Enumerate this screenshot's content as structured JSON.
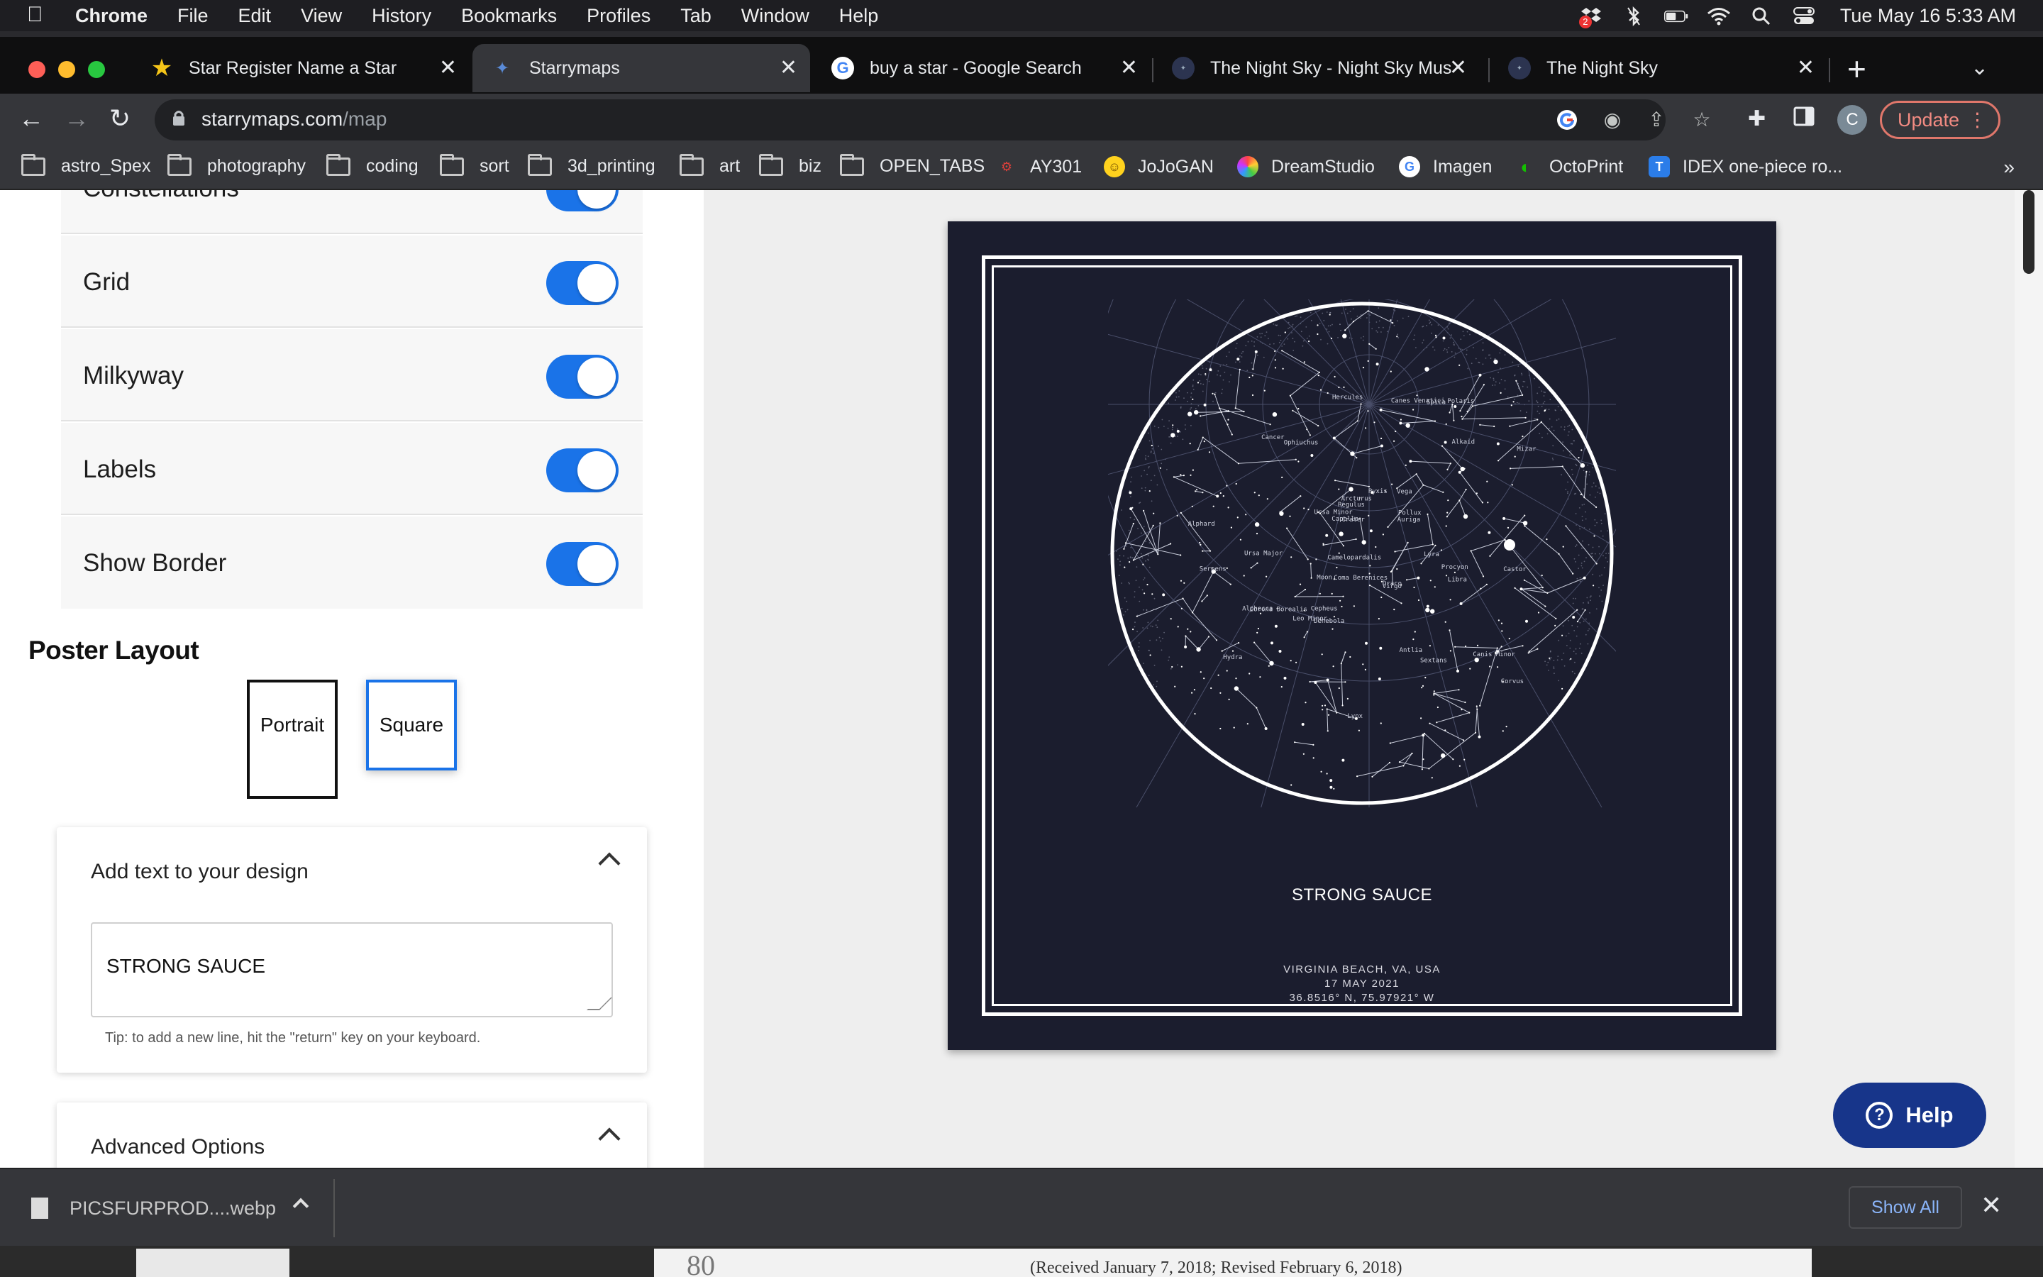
{
  "menubar": {
    "app_name": "Chrome",
    "items": [
      "File",
      "Edit",
      "View",
      "History",
      "Bookmarks",
      "Profiles",
      "Tab",
      "Window",
      "Help"
    ],
    "clock": "Tue May 16  5:33 AM",
    "badge": "2"
  },
  "tabs": [
    {
      "title": "Star Register Name a Star",
      "icon": "star-icon"
    },
    {
      "title": "Starrymaps",
      "icon": "starrymaps-icon"
    },
    {
      "title": "buy a star - Google Search",
      "icon": "google-icon"
    },
    {
      "title": "The Night Sky - Night Sky Mus",
      "icon": "nightsky-icon"
    },
    {
      "title": "The Night Sky",
      "icon": "nightsky-icon"
    }
  ],
  "address": {
    "domain": "starrymaps.com",
    "path": "/map"
  },
  "profile_initial": "C",
  "update_label": "Update",
  "bookmarks": [
    {
      "label": "astro_Spex",
      "type": "folder"
    },
    {
      "label": "photography",
      "type": "folder"
    },
    {
      "label": "coding",
      "type": "folder"
    },
    {
      "label": "sort",
      "type": "folder"
    },
    {
      "label": "3d_printing",
      "type": "folder"
    },
    {
      "label": "art",
      "type": "folder"
    },
    {
      "label": "biz",
      "type": "folder"
    },
    {
      "label": "OPEN_TABS",
      "type": "folder"
    },
    {
      "label": "AY301",
      "type": "site"
    },
    {
      "label": "JoJoGAN",
      "type": "site"
    },
    {
      "label": "DreamStudio",
      "type": "site"
    },
    {
      "label": "Imagen",
      "type": "site"
    },
    {
      "label": "OctoPrint",
      "type": "site"
    },
    {
      "label": "IDEX one-piece ro...",
      "type": "site"
    }
  ],
  "bookmarks_more": "»",
  "sidebar": {
    "partial_row": "Constellations",
    "toggles": [
      {
        "label": "Grid",
        "on": true
      },
      {
        "label": "Milkyway",
        "on": true
      },
      {
        "label": "Labels",
        "on": true
      },
      {
        "label": "Show Border",
        "on": true
      }
    ],
    "layout_title": "Poster Layout",
    "layout_options": [
      "Portrait",
      "Square"
    ],
    "layout_selected": "Square",
    "text_card": {
      "title": "Add text to your design",
      "value": "STRONG SAUCE",
      "tip": "Tip: to add a new line, hit the \"return\" key on your keyboard."
    },
    "advanced_title": "Advanced Options"
  },
  "poster": {
    "title": "STRONG SAUCE",
    "location": "VIRGINIA BEACH, VA, USA",
    "date": "17 MAY 2021",
    "coords": "36.8516° N, 75.97921° W",
    "background_color": "#1b1d2e",
    "constellation_labels": [
      "Camelopardalis",
      "Polaris",
      "Ursa Minor",
      "Capella",
      "Auriga",
      "Draco",
      "Cepheus",
      "Lynx",
      "Ursa Major",
      "Castor",
      "Pollux",
      "Hercules",
      "Corona Borealis",
      "Canes Venatici",
      "Leo Minor",
      "Cancer",
      "Canis Minor",
      "Procyon",
      "Alphecca",
      "Arcturus",
      "Coma Berenices",
      "Regulus",
      "Denebola",
      "Sextans",
      "Alphard",
      "Virgo",
      "Spica",
      "Libra",
      "Corvus",
      "Crater",
      "Hydra",
      "Pyxis",
      "Antlia",
      "Serpens",
      "Ophiuchus",
      "Vega",
      "Lyra",
      "Alkaid",
      "Mizar",
      "Moon"
    ]
  },
  "help_label": "Help",
  "downloads": {
    "file": "PICSFURPROD....webp",
    "show_all": "Show All"
  },
  "background_window": {
    "caption": "(Received January 7, 2018; Revised February 6, 2018)",
    "page_num": "80"
  }
}
